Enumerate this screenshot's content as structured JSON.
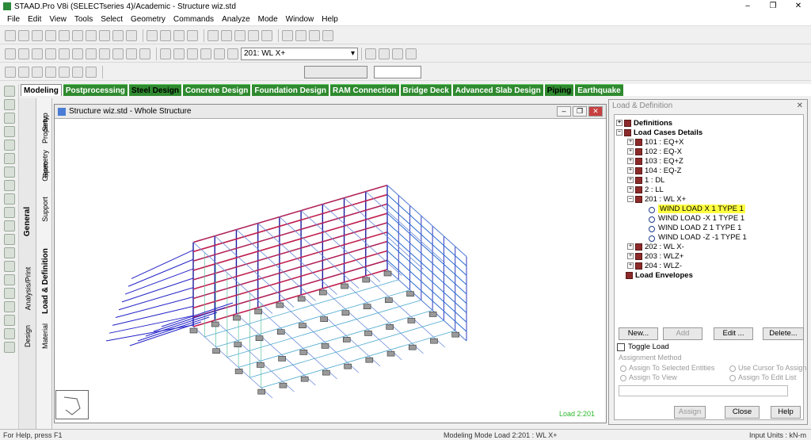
{
  "window": {
    "title": "STAAD.Pro V8i (SELECTseries 4)/Academic - Structure wiz.std",
    "min": "–",
    "max": "❐",
    "close": "✕"
  },
  "menu": [
    "File",
    "Edit",
    "View",
    "Tools",
    "Select",
    "Geometry",
    "Commands",
    "Analyze",
    "Mode",
    "Window",
    "Help"
  ],
  "toolbar": {
    "load_case_select": "201: WL X+"
  },
  "tabs": [
    "Modeling",
    "Postprocessing",
    "Steel Design",
    "Concrete Design",
    "Foundation Design",
    "RAM Connection",
    "Bridge Deck",
    "Advanced Slab Design",
    "Piping",
    "Earthquake"
  ],
  "side_tabs_outer": [
    "General",
    "Analysis/Print",
    "Design"
  ],
  "side_tabs_inner": [
    "Setup",
    "Geometry",
    "Property",
    "Spec",
    "Support",
    "Load & Definition",
    "Material"
  ],
  "viewport": {
    "title": "Structure wiz.std - Whole Structure",
    "load_label": "Load 2:201"
  },
  "panel": {
    "title": "Load & Definition",
    "close": "✕",
    "tree": {
      "definitions": "Definitions",
      "load_cases_details": "Load Cases Details",
      "cases": [
        "101 : EQ+X",
        "102 : EQ-X",
        "103 : EQ+Z",
        "104 : EQ-Z",
        "1 : DL",
        "2 : LL",
        "201 : WL X+"
      ],
      "children": [
        "WIND LOAD X 1 TYPE 1",
        "WIND LOAD -X 1 TYPE 1",
        "WIND LOAD Z 1 TYPE 1",
        "WIND LOAD -Z -1 TYPE 1"
      ],
      "cases_after": [
        "202 : WL X-",
        "203 : WLZ+",
        "204 : WLZ-"
      ],
      "load_envelopes": "Load Envelopes"
    },
    "buttons": {
      "new": "New...",
      "add": "Add",
      "edit": "Edit ...",
      "delete": "Delete..."
    },
    "toggle_load": "Toggle Load",
    "assignment_method": "Assignment Method",
    "assign_options": [
      "Assign To Selected Entities",
      "Assign To View",
      "Use Cursor To Assign",
      "Assign To Edit List"
    ],
    "footer_buttons": {
      "assign": "Assign",
      "close": "Close",
      "help": "Help"
    }
  },
  "status": {
    "left": "For Help, press F1",
    "mid": "Modeling Mode   Load 2:201 : WL X+",
    "right": "Input Units : kN-m"
  }
}
